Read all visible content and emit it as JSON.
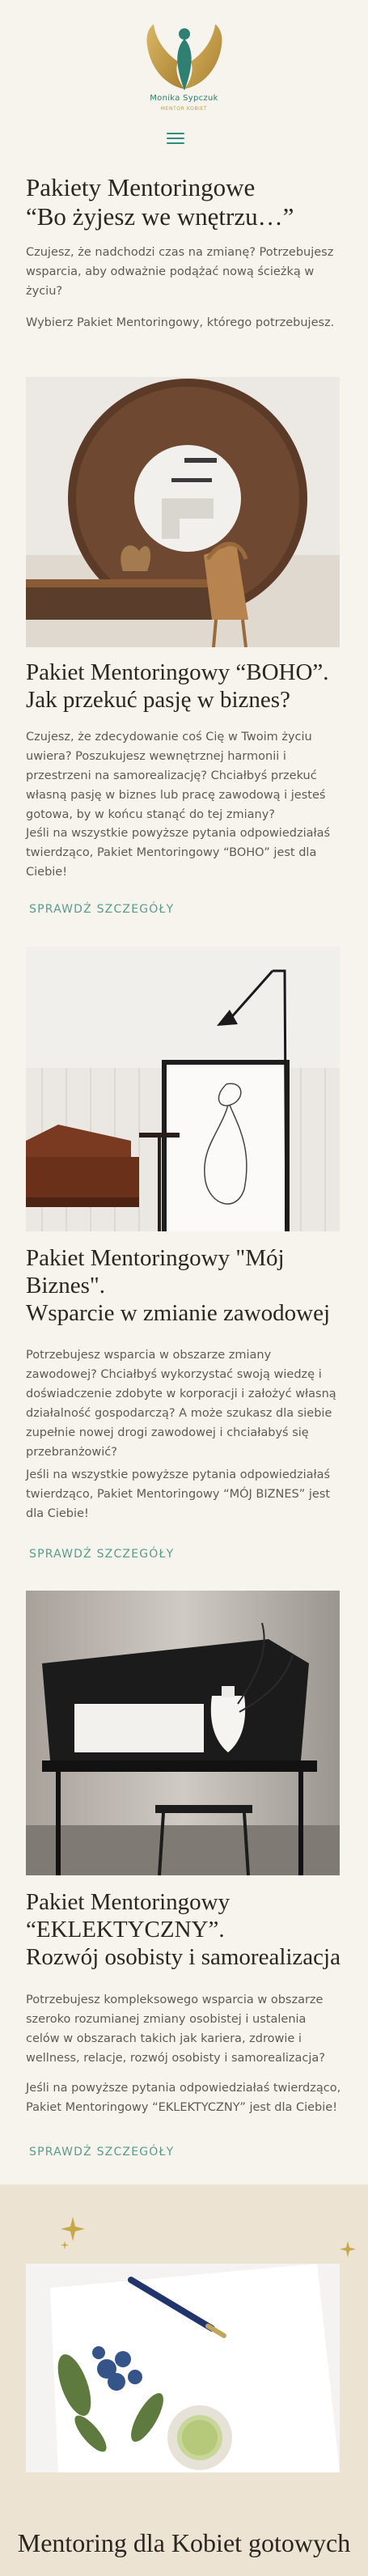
{
  "header": {
    "brand_name": "Monika Sypczuk",
    "brand_tagline": "MENTOR KOBIET",
    "menu_icon": "hamburger-menu-icon"
  },
  "intro": {
    "title_line1": "Pakiety Mentoringowe",
    "title_line2": "“Bo żyjesz we wnętrzu…”",
    "paragraph1": "Czujesz, że nadchodzi czas na zmianę? Potrzebujesz wsparcia, aby odważnie podążać nową ścieżką w życiu?",
    "paragraph2": "Wybierz Pakiet Mentoringowy, którego potrzebujesz."
  },
  "packages": [
    {
      "image": "round-mirror-wooden-chair-photo",
      "title_line1": "Pakiet Mentoringowy “BOHO”.",
      "title_line2": "Jak przekuć pasję w biznes?",
      "paragraph1": "Czujesz, że zdecydowanie coś Cię w Twoim życiu uwiera? Poszukujesz wewnętrznej harmonii i przestrzeni na samorealizację? Chciałbyś przekuć własną pasję w biznes lub pracę zawodową i jesteś gotowa, by w końcu stanąć do tej zmiany?",
      "paragraph2": "Jeśli na wszystkie powyższe pytania odpowiedziałaś twierdząco, Pakiet Mentoringowy “BOHO” jest dla Ciebie!",
      "link": "SPRAWDŹ SZCZEGÓŁY"
    },
    {
      "image": "leather-armchair-line-art-poster-photo",
      "title_line1": "Pakiet Mentoringowy \"Mój",
      "title_line2": "Biznes\".",
      "title_line3": "Wsparcie w zmianie zawodowej",
      "paragraph1": "Potrzebujesz wsparcia w obszarze zmiany zawodowej? Chciałbyś wykorzystać swoją wiedzę i doświadczenie zdobyte w korporacji i założyć własną działalność gospodarczą? A może szukasz dla siebie zupełnie nowej drogi zawodowej i chciałabyś się przebranżowić?",
      "paragraph2": "Jeśli na wszystkie powyższe pytania odpowiedziałaś twierdząco, Pakiet Mentoringowy “MÓJ BIZNES” jest dla Ciebie!",
      "link": "SPRAWDŹ SZCZEGÓŁY"
    },
    {
      "image": "black-desk-white-vase-photo",
      "title_line1": "Pakiet Mentoringowy",
      "title_line2": "“EKLEKTYCZNY”.",
      "title_line3": "Rozwój osobisty i samorealizacja",
      "paragraph1": "Potrzebujesz kompleksowego wsparcia w obszarze szeroko rozumianej zmiany osobistej i ustalenia celów w obszarach takich jak kariera, zdrowie i wellness, relacje, rozwój osobisty i samorealizacja?",
      "paragraph2": "Jeśli na powyższe pytania odpowiedziałaś twierdząco, Pakiet Mentoringowy “EKLEKTYCZNY” jest dla Ciebie!",
      "link": "SPRAWDŹ SZCZEGÓŁY"
    }
  ],
  "bottom": {
    "image": "notebook-pen-flowers-matcha-photo",
    "title": "Mentoring dla Kobiet gotowych"
  },
  "colors": {
    "background": "#f7f4ee",
    "accent_teal": "#5a9a8d",
    "gold": "#b8a24a",
    "band": "#ece3d3"
  }
}
